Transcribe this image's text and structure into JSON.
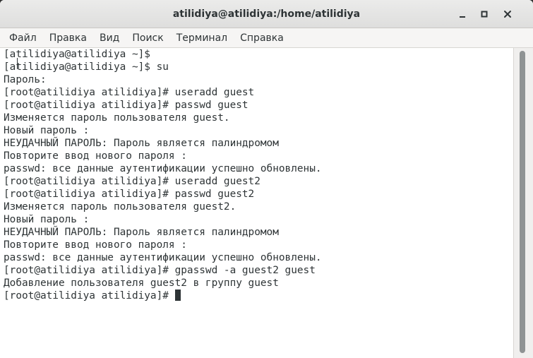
{
  "window": {
    "title": "atilidiya@atilidiya:/home/atilidiya"
  },
  "menu": {
    "items": [
      "Файл",
      "Правка",
      "Вид",
      "Поиск",
      "Терминал",
      "Справка"
    ]
  },
  "terminal": {
    "lines": [
      "[atilidiya@atilidiya ~]$",
      "[atilidiya@atilidiya ~]$ su",
      "Пароль:",
      "[root@atilidiya atilidiya]# useradd guest",
      "[root@atilidiya atilidiya]# passwd guest",
      "Изменяется пароль пользователя guest.",
      "Новый пароль :",
      "НЕУДАЧНЫЙ ПАРОЛЬ: Пароль является палиндромом",
      "Повторите ввод нового пароля :",
      "passwd: все данные аутентификации успешно обновлены.",
      "[root@atilidiya atilidiya]# useradd guest2",
      "[root@atilidiya atilidiya]# passwd guest2",
      "Изменяется пароль пользователя guest2.",
      "Новый пароль :",
      "НЕУДАЧНЫЙ ПАРОЛЬ: Пароль является палиндромом",
      "Повторите ввод нового пароля :",
      "passwd: все данные аутентификации успешно обновлены.",
      "[root@atilidiya atilidiya]# gpasswd -a guest2 guest",
      "Добавление пользователя guest2 в группу guest"
    ],
    "prompt": "[root@atilidiya atilidiya]# "
  },
  "colors": {
    "text": "#2e3436",
    "background": "#ffffff",
    "chrome": "#f6f5f4"
  },
  "icons": {
    "minimize": "minimize-icon",
    "maximize": "maximize-icon",
    "close": "close-icon"
  }
}
